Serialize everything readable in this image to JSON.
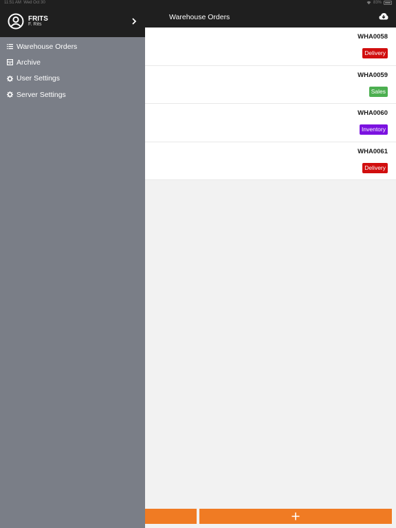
{
  "status_bar": {
    "time": "11:51 AM",
    "date": "Wed Oct 30",
    "battery": "83%"
  },
  "header": {
    "title": "Warehouse Orders"
  },
  "user": {
    "name": "FRITS",
    "subtitle": "F. Rits"
  },
  "menu": {
    "items": [
      {
        "label": "Warehouse Orders",
        "icon": "list-icon"
      },
      {
        "label": "Archive",
        "icon": "archive-icon"
      },
      {
        "label": "User Settings",
        "icon": "gear-icon"
      },
      {
        "label": "Server Settings",
        "icon": "gear-icon"
      }
    ]
  },
  "orders": [
    {
      "id": "WHA0058",
      "type": "Delivery",
      "color": "#d10e0e"
    },
    {
      "id": "WHA0059",
      "type": "Sales",
      "color": "#4caf50"
    },
    {
      "id": "WHA0060",
      "type": "Inventory",
      "color": "#7b12e0"
    },
    {
      "id": "WHA0061",
      "type": "Delivery",
      "color": "#d10e0e"
    }
  ],
  "colors": {
    "accent": "#f07b23",
    "header": "#1f1f1f",
    "drawer": "#7a7e87"
  }
}
